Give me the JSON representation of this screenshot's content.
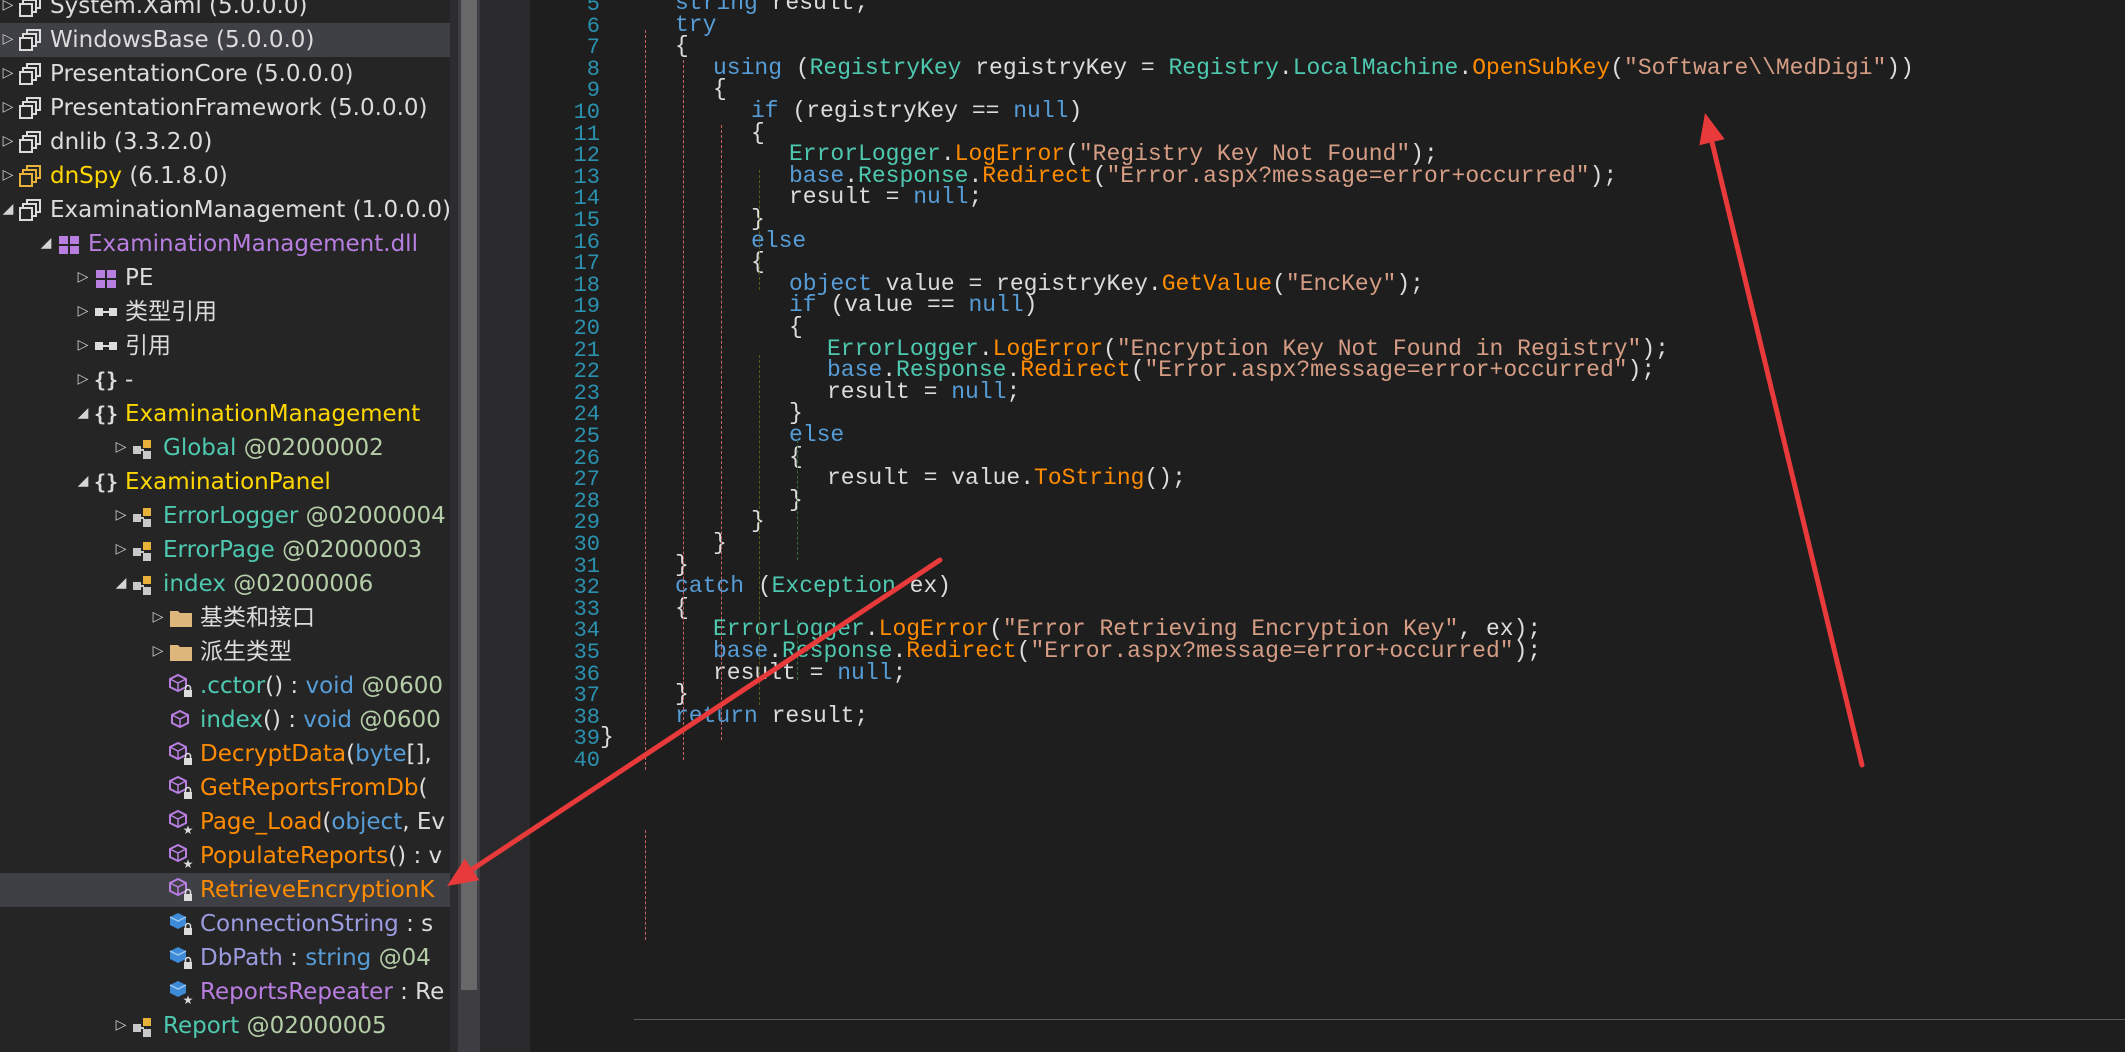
{
  "tree": {
    "rows": [
      {
        "indent": 0,
        "twisty": "▷",
        "icon": "assembly-icon",
        "parts": [
          {
            "t": "System.Xaml ",
            "c": "default"
          },
          {
            "t": "(5.0.0.0)",
            "c": "ver"
          }
        ]
      },
      {
        "indent": 0,
        "twisty": "▷",
        "icon": "assembly-icon",
        "selected": true,
        "parts": [
          {
            "t": "WindowsBase ",
            "c": "default"
          },
          {
            "t": "(5.0.0.0)",
            "c": "ver"
          }
        ]
      },
      {
        "indent": 0,
        "twisty": "▷",
        "icon": "assembly-icon",
        "parts": [
          {
            "t": "PresentationCore ",
            "c": "default"
          },
          {
            "t": "(5.0.0.0)",
            "c": "ver"
          }
        ]
      },
      {
        "indent": 0,
        "twisty": "▷",
        "icon": "assembly-icon",
        "parts": [
          {
            "t": "PresentationFramework ",
            "c": "default"
          },
          {
            "t": "(5.0.0.0)",
            "c": "ver"
          }
        ]
      },
      {
        "indent": 0,
        "twisty": "▷",
        "icon": "assembly-icon",
        "parts": [
          {
            "t": "dnlib ",
            "c": "default"
          },
          {
            "t": "(3.3.2.0)",
            "c": "ver"
          }
        ]
      },
      {
        "indent": 0,
        "twisty": "▷",
        "icon": "assembly-gold-icon",
        "parts": [
          {
            "t": "dnSpy ",
            "c": "nsy"
          },
          {
            "t": "(6.1.8.0)",
            "c": "ver"
          }
        ]
      },
      {
        "indent": 0,
        "twisty": "◢",
        "icon": "assembly-icon",
        "parts": [
          {
            "t": "ExaminationManagement ",
            "c": "default"
          },
          {
            "t": "(1.0.0.0)",
            "c": "ver"
          }
        ]
      },
      {
        "indent": 1,
        "twisty": "◢",
        "icon": "module-icon",
        "parts": [
          {
            "t": "ExaminationManagement.dll",
            "c": "dll"
          }
        ]
      },
      {
        "indent": 2,
        "twisty": "▷",
        "icon": "pe-icon",
        "parts": [
          {
            "t": "PE",
            "c": "default"
          }
        ]
      },
      {
        "indent": 2,
        "twisty": "▷",
        "icon": "reference-icon",
        "parts": [
          {
            "t": "类型引用",
            "c": "default"
          }
        ]
      },
      {
        "indent": 2,
        "twisty": "▷",
        "icon": "reference-icon",
        "parts": [
          {
            "t": "引用",
            "c": "default"
          }
        ]
      },
      {
        "indent": 2,
        "twisty": "▷",
        "icon": "namespace-icon",
        "parts": [
          {
            "t": "-",
            "c": "default"
          }
        ]
      },
      {
        "indent": 2,
        "twisty": "◢",
        "icon": "namespace-icon",
        "parts": [
          {
            "t": "ExaminationManagement",
            "c": "nsy"
          }
        ]
      },
      {
        "indent": 3,
        "twisty": "▷",
        "icon": "class-icon",
        "parts": [
          {
            "t": "Global ",
            "c": "class"
          },
          {
            "t": "@02000002",
            "c": "tok"
          }
        ]
      },
      {
        "indent": 2,
        "twisty": "◢",
        "icon": "namespace-icon",
        "parts": [
          {
            "t": "ExaminationPanel",
            "c": "nsy"
          }
        ]
      },
      {
        "indent": 3,
        "twisty": "▷",
        "icon": "class-icon",
        "parts": [
          {
            "t": "ErrorLogger ",
            "c": "methodg"
          },
          {
            "t": "@02000004",
            "c": "tok"
          }
        ]
      },
      {
        "indent": 3,
        "twisty": "▷",
        "icon": "class-icon",
        "parts": [
          {
            "t": "ErrorPage ",
            "c": "class"
          },
          {
            "t": "@02000003",
            "c": "tok"
          }
        ]
      },
      {
        "indent": 3,
        "twisty": "◢",
        "icon": "class-icon",
        "parts": [
          {
            "t": "index ",
            "c": "class"
          },
          {
            "t": "@02000006",
            "c": "tok"
          }
        ]
      },
      {
        "indent": 4,
        "twisty": "▷",
        "icon": "folder-icon",
        "parts": [
          {
            "t": "基类和接口",
            "c": "default"
          }
        ]
      },
      {
        "indent": 4,
        "twisty": "▷",
        "icon": "folder-icon",
        "parts": [
          {
            "t": "派生类型",
            "c": "default"
          }
        ]
      },
      {
        "indent": 4,
        "twisty": "",
        "icon": "method-lock-icon",
        "parts": [
          {
            "t": ".cctor",
            "c": "methodg"
          },
          {
            "t": "() : ",
            "c": "default"
          },
          {
            "t": "void ",
            "c": "kw"
          },
          {
            "t": "@0600",
            "c": "tok"
          }
        ]
      },
      {
        "indent": 4,
        "twisty": "",
        "icon": "method-icon",
        "parts": [
          {
            "t": "index",
            "c": "methodg"
          },
          {
            "t": "() : ",
            "c": "default"
          },
          {
            "t": "void ",
            "c": "kw"
          },
          {
            "t": "@0600",
            "c": "tok"
          }
        ]
      },
      {
        "indent": 4,
        "twisty": "",
        "icon": "method-lock-icon",
        "parts": [
          {
            "t": "DecryptData",
            "c": "method"
          },
          {
            "t": "(",
            "c": "default"
          },
          {
            "t": "byte",
            "c": "kw"
          },
          {
            "t": "[],",
            "c": "default"
          }
        ]
      },
      {
        "indent": 4,
        "twisty": "",
        "icon": "method-lock-icon",
        "parts": [
          {
            "t": "GetReportsFromDb",
            "c": "method"
          },
          {
            "t": "(",
            "c": "default"
          }
        ]
      },
      {
        "indent": 4,
        "twisty": "",
        "icon": "method-star-icon",
        "parts": [
          {
            "t": "Page_Load",
            "c": "method"
          },
          {
            "t": "(",
            "c": "default"
          },
          {
            "t": "object",
            "c": "kw"
          },
          {
            "t": ", Ev",
            "c": "default"
          }
        ]
      },
      {
        "indent": 4,
        "twisty": "",
        "icon": "method-star-icon",
        "parts": [
          {
            "t": "PopulateReports",
            "c": "method"
          },
          {
            "t": "() : v",
            "c": "default"
          }
        ]
      },
      {
        "indent": 4,
        "twisty": "",
        "icon": "method-lock-icon",
        "selected": true,
        "parts": [
          {
            "t": "RetrieveEncryptionK",
            "c": "method"
          }
        ]
      },
      {
        "indent": 4,
        "twisty": "",
        "icon": "field-lock-icon",
        "parts": [
          {
            "t": "ConnectionString",
            "c": "field"
          },
          {
            "t": " : s",
            "c": "default"
          }
        ]
      },
      {
        "indent": 4,
        "twisty": "",
        "icon": "field-lock-icon",
        "parts": [
          {
            "t": "DbPath",
            "c": "field"
          },
          {
            "t": " : ",
            "c": "default"
          },
          {
            "t": "string ",
            "c": "kw"
          },
          {
            "t": "@04",
            "c": "tok"
          }
        ]
      },
      {
        "indent": 4,
        "twisty": "",
        "icon": "field-star-icon",
        "parts": [
          {
            "t": "ReportsRepeater",
            "c": "prop"
          },
          {
            "t": " : Re",
            "c": "default"
          }
        ]
      },
      {
        "indent": 3,
        "twisty": "▷",
        "icon": "class-icon",
        "parts": [
          {
            "t": "Report ",
            "c": "class"
          },
          {
            "t": "@02000005",
            "c": "tok"
          }
        ]
      }
    ]
  },
  "code": {
    "lines": [
      {
        "n": "5",
        "ind": 1,
        "tokens": [
          [
            "k",
            "string"
          ],
          [
            "d",
            " result;"
          ]
        ]
      },
      {
        "n": "6",
        "ind": 1,
        "tokens": [
          [
            "k",
            "try"
          ]
        ]
      },
      {
        "n": "7",
        "ind": 1,
        "tokens": [
          [
            "d",
            "{"
          ]
        ]
      },
      {
        "n": "8",
        "ind": 2,
        "tokens": [
          [
            "k",
            "using"
          ],
          [
            "d",
            " ("
          ],
          [
            "t",
            "RegistryKey"
          ],
          [
            "d",
            " registryKey = "
          ],
          [
            "t",
            "Registry"
          ],
          [
            "d",
            "."
          ],
          [
            "t",
            "LocalMachine"
          ],
          [
            "d",
            "."
          ],
          [
            "m",
            "OpenSubKey"
          ],
          [
            "d",
            "("
          ],
          [
            "s",
            "\"Software\\\\MedDigi\""
          ],
          [
            "d",
            "))"
          ]
        ]
      },
      {
        "n": "9",
        "ind": 2,
        "tokens": [
          [
            "d",
            "{"
          ]
        ]
      },
      {
        "n": "10",
        "ind": 3,
        "tokens": [
          [
            "k",
            "if"
          ],
          [
            "d",
            " (registryKey == "
          ],
          [
            "k",
            "null"
          ],
          [
            "d",
            ")"
          ]
        ]
      },
      {
        "n": "11",
        "ind": 3,
        "tokens": [
          [
            "d",
            "{"
          ]
        ]
      },
      {
        "n": "12",
        "ind": 4,
        "tokens": [
          [
            "t",
            "ErrorLogger"
          ],
          [
            "d",
            "."
          ],
          [
            "m",
            "LogError"
          ],
          [
            "d",
            "("
          ],
          [
            "s",
            "\"Registry Key Not Found\""
          ],
          [
            "d",
            ");"
          ]
        ]
      },
      {
        "n": "13",
        "ind": 4,
        "tokens": [
          [
            "k",
            "base"
          ],
          [
            "d",
            "."
          ],
          [
            "t",
            "Response"
          ],
          [
            "d",
            "."
          ],
          [
            "m",
            "Redirect"
          ],
          [
            "d",
            "("
          ],
          [
            "s",
            "\"Error.aspx?message=error+occurred\""
          ],
          [
            "d",
            ");"
          ]
        ]
      },
      {
        "n": "14",
        "ind": 4,
        "tokens": [
          [
            "d",
            "result = "
          ],
          [
            "k",
            "null"
          ],
          [
            "d",
            ";"
          ]
        ]
      },
      {
        "n": "15",
        "ind": 3,
        "tokens": [
          [
            "d",
            "}"
          ]
        ]
      },
      {
        "n": "16",
        "ind": 3,
        "tokens": [
          [
            "k",
            "else"
          ]
        ]
      },
      {
        "n": "17",
        "ind": 3,
        "tokens": [
          [
            "d",
            "{"
          ]
        ]
      },
      {
        "n": "18",
        "ind": 4,
        "tokens": [
          [
            "k",
            "object"
          ],
          [
            "d",
            " value = registryKey."
          ],
          [
            "m",
            "GetValue"
          ],
          [
            "d",
            "("
          ],
          [
            "s",
            "\"EncKey\""
          ],
          [
            "d",
            ");"
          ]
        ]
      },
      {
        "n": "19",
        "ind": 4,
        "tokens": [
          [
            "k",
            "if"
          ],
          [
            "d",
            " (value == "
          ],
          [
            "k",
            "null"
          ],
          [
            "d",
            ")"
          ]
        ]
      },
      {
        "n": "20",
        "ind": 4,
        "tokens": [
          [
            "d",
            "{"
          ]
        ]
      },
      {
        "n": "21",
        "ind": 5,
        "tokens": [
          [
            "t",
            "ErrorLogger"
          ],
          [
            "d",
            "."
          ],
          [
            "m",
            "LogError"
          ],
          [
            "d",
            "("
          ],
          [
            "s",
            "\"Encryption Key Not Found in Registry\""
          ],
          [
            "d",
            ");"
          ]
        ]
      },
      {
        "n": "22",
        "ind": 5,
        "tokens": [
          [
            "k",
            "base"
          ],
          [
            "d",
            "."
          ],
          [
            "t",
            "Response"
          ],
          [
            "d",
            "."
          ],
          [
            "m",
            "Redirect"
          ],
          [
            "d",
            "("
          ],
          [
            "s",
            "\"Error.aspx?message=error+occurred\""
          ],
          [
            "d",
            ");"
          ]
        ]
      },
      {
        "n": "23",
        "ind": 5,
        "tokens": [
          [
            "d",
            "result = "
          ],
          [
            "k",
            "null"
          ],
          [
            "d",
            ";"
          ]
        ]
      },
      {
        "n": "24",
        "ind": 4,
        "tokens": [
          [
            "d",
            "}"
          ]
        ]
      },
      {
        "n": "25",
        "ind": 4,
        "tokens": [
          [
            "k",
            "else"
          ]
        ]
      },
      {
        "n": "26",
        "ind": 4,
        "tokens": [
          [
            "d",
            "{"
          ]
        ]
      },
      {
        "n": "27",
        "ind": 5,
        "tokens": [
          [
            "d",
            "result = value."
          ],
          [
            "m",
            "ToString"
          ],
          [
            "d",
            "();"
          ]
        ]
      },
      {
        "n": "28",
        "ind": 4,
        "tokens": [
          [
            "d",
            "}"
          ]
        ]
      },
      {
        "n": "29",
        "ind": 3,
        "tokens": [
          [
            "d",
            "}"
          ]
        ]
      },
      {
        "n": "30",
        "ind": 2,
        "tokens": [
          [
            "d",
            "}"
          ]
        ]
      },
      {
        "n": "31",
        "ind": 1,
        "tokens": [
          [
            "d",
            "}"
          ]
        ]
      },
      {
        "n": "32",
        "ind": 1,
        "tokens": [
          [
            "k",
            "catch"
          ],
          [
            "d",
            " ("
          ],
          [
            "t",
            "Exception"
          ],
          [
            "d",
            " ex)"
          ]
        ]
      },
      {
        "n": "33",
        "ind": 1,
        "tokens": [
          [
            "d",
            "{"
          ]
        ]
      },
      {
        "n": "34",
        "ind": 2,
        "tokens": [
          [
            "t",
            "ErrorLogger"
          ],
          [
            "d",
            "."
          ],
          [
            "m",
            "LogError"
          ],
          [
            "d",
            "("
          ],
          [
            "s",
            "\"Error Retrieving Encryption Key\""
          ],
          [
            "d",
            ", ex);"
          ]
        ]
      },
      {
        "n": "35",
        "ind": 2,
        "tokens": [
          [
            "k",
            "base"
          ],
          [
            "d",
            "."
          ],
          [
            "t",
            "Response"
          ],
          [
            "d",
            "."
          ],
          [
            "m",
            "Redirect"
          ],
          [
            "d",
            "("
          ],
          [
            "s",
            "\"Error.aspx?message=error+occurred\""
          ],
          [
            "d",
            ");"
          ]
        ]
      },
      {
        "n": "36",
        "ind": 2,
        "tokens": [
          [
            "d",
            "result = "
          ],
          [
            "k",
            "null"
          ],
          [
            "d",
            ";"
          ]
        ]
      },
      {
        "n": "37",
        "ind": 1,
        "tokens": [
          [
            "d",
            "}"
          ]
        ]
      },
      {
        "n": "38",
        "ind": 1,
        "tokens": [
          [
            "k",
            "return"
          ],
          [
            "d",
            " result;"
          ]
        ]
      },
      {
        "n": "39",
        "ind": 0,
        "tokens": [
          [
            "d",
            "}"
          ]
        ]
      },
      {
        "n": "40",
        "ind": 0,
        "tokens": []
      }
    ]
  },
  "annotations": {
    "arrow_color": "#e83a3a"
  }
}
